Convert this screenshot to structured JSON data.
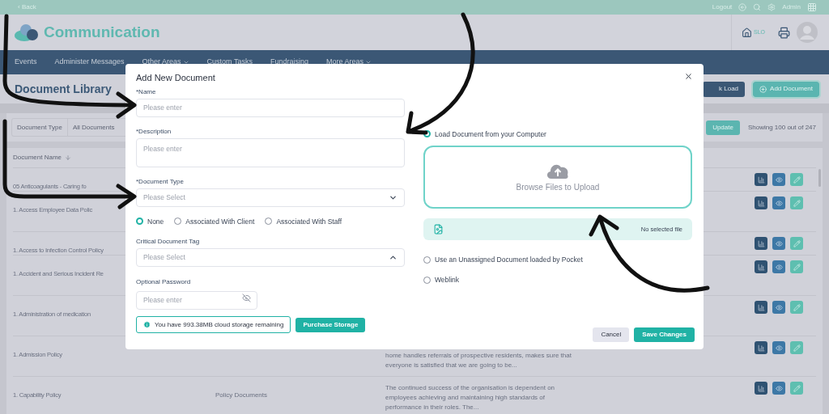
{
  "top_bar": {
    "back": "‹ Back",
    "logout": "Logout",
    "user": "Admin"
  },
  "header": {
    "app_title": "Communication",
    "home_label": "SLO"
  },
  "nav": [
    {
      "label": "Events",
      "has_menu": false
    },
    {
      "label": "Administer Messages",
      "has_menu": false
    },
    {
      "label": "Other Areas",
      "has_menu": true
    },
    {
      "label": "Custom Tasks",
      "has_menu": false
    },
    {
      "label": "Fundraising",
      "has_menu": false
    },
    {
      "label": "More Areas",
      "has_menu": true
    }
  ],
  "page": {
    "title": "Document Library",
    "bulk_load": "k Load",
    "add_document": "Add Document",
    "filter_label": "Document Type",
    "filter_value": "All Documents",
    "update": "Update",
    "count": "Showing 100 out of 247"
  },
  "table": {
    "columns": [
      "Document Name"
    ],
    "rows": [
      {
        "name": "05 Anticoagulants - Caring fo"
      },
      {
        "name": "1. Access Employee Data Polic"
      },
      {
        "name": "1. Access to Infection Control Policy"
      },
      {
        "name": "1. Accident and Serious Incident Re"
      },
      {
        "name": "1. Administration of medication"
      },
      {
        "name": "1. Admission Policy",
        "description": "home handles referrals of prospective residents, makes sure that everyone is satisfied that we are going to be..."
      },
      {
        "name": "1. Capability Policy",
        "category": "Policy Documents",
        "description": "The continued success of the organisation is dependent on employees achieving and maintaining high standards of performance in their roles. The..."
      }
    ]
  },
  "modal": {
    "title": "Add New Document",
    "name": {
      "label": "*Name",
      "placeholder": "Please enter"
    },
    "description": {
      "label": "*Description",
      "placeholder": "Please enter"
    },
    "document_type": {
      "label": "*Document Type",
      "placeholder": "Please Select",
      "expanded": false
    },
    "association": [
      {
        "label": "None",
        "selected": true
      },
      {
        "label": "Associated With Client",
        "selected": false
      },
      {
        "label": "Associated With Staff",
        "selected": false
      }
    ],
    "critical_tag": {
      "label": "Critical Document Tag",
      "placeholder": "Please Select",
      "expanded": true
    },
    "password": {
      "label": "Optional Password",
      "placeholder": "Please enter"
    },
    "storage_notice": "You have 993.38MB cloud storage remaining",
    "purchase": "Purchase Storage",
    "sources": [
      {
        "kind": "upload",
        "label": "Load Document from your Computer",
        "selected": true
      },
      {
        "kind": "option",
        "label": "Use an Unassigned Document loaded by Pocket",
        "selected": false
      },
      {
        "kind": "option",
        "label": "Weblink",
        "selected": false
      }
    ],
    "upload_box": "Browse Files to Upload",
    "file_status": "No selected file",
    "cancel": "Cancel",
    "save": "Save Changes"
  }
}
